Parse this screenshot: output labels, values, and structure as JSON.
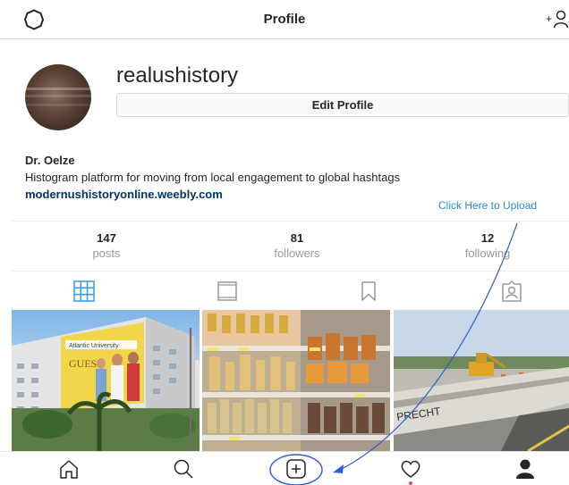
{
  "header": {
    "title": "Profile"
  },
  "profile": {
    "username": "realushistory",
    "edit_label": "Edit Profile",
    "display_name": "Dr. Oelze",
    "bio": "Histogram platform for moving from local engagement to global hashtags",
    "website": "modernushistoryonline.weebly.com"
  },
  "annotation": {
    "upload_text": "Click Here to Upload",
    "color": "#2b5fd9"
  },
  "stats": {
    "posts": {
      "value": "147",
      "label": "posts"
    },
    "followers": {
      "value": "81",
      "label": "followers"
    },
    "following": {
      "value": "12",
      "label": "following"
    }
  },
  "tabs": {
    "active": "grid",
    "items": [
      "grid-icon",
      "feed-icon",
      "saved-icon",
      "tagged-icon"
    ],
    "active_color": "#3897f0"
  },
  "photos": [
    {
      "caption_sign": "GUESS",
      "banner_text": "Atlantic University"
    },
    {
      "scene": "store-shelf"
    },
    {
      "sign_text": "PRECHT"
    }
  ],
  "bottom_nav": {
    "items": [
      "home-icon",
      "search-icon",
      "new-post-icon",
      "activity-icon",
      "profile-icon"
    ],
    "notification_color": "#ed4956"
  }
}
